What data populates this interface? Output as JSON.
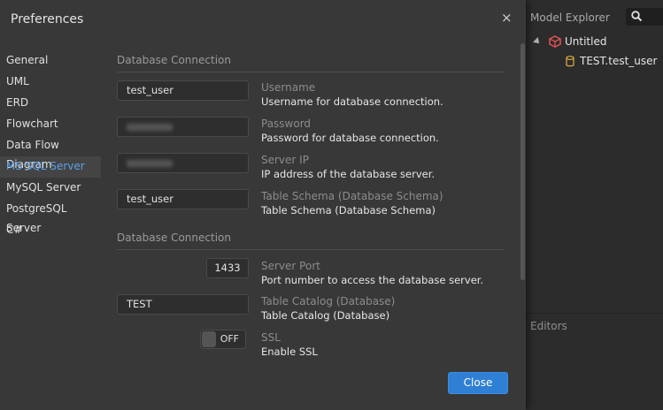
{
  "explorer": {
    "title": "Model Explorer",
    "tree": [
      {
        "label": "Untitled",
        "icon": "cube-icon"
      },
      {
        "label": "TEST.test_user",
        "icon": "database-icon"
      }
    ],
    "editors_label": "Editors"
  },
  "dialog": {
    "title": "Preferences",
    "close_symbol": "×",
    "nav": [
      "General",
      "UML",
      "ERD",
      "Flowchart",
      "Data Flow Diagram",
      "MS SQL Server",
      "MySQL Server",
      "PostgreSQL Server",
      "C#"
    ],
    "active_nav": "MS SQL Server",
    "sections": [
      "Database Connection",
      "Database Connection"
    ],
    "fields": {
      "username": {
        "value": "test_user",
        "title": "Username",
        "desc": "Username for database connection."
      },
      "password": {
        "value": "",
        "title": "Password",
        "desc": "Password for database connection."
      },
      "server_ip": {
        "value": "",
        "title": "Server IP",
        "desc": "IP address of the database server."
      },
      "table_schema": {
        "value": "test_user",
        "title": "Table Schema (Database Schema)",
        "desc": "Table Schema (Database Schema)"
      },
      "server_port": {
        "value": "1433",
        "title": "Server Port",
        "desc": "Port number to access the database server."
      },
      "table_catalog": {
        "value": "TEST",
        "title": "Table Catalog (Database)",
        "desc": "Table Catalog (Database)"
      },
      "ssl": {
        "value": "OFF",
        "title": "SSL",
        "desc": "Enable SSL"
      }
    },
    "close_button": "Close"
  },
  "colors": {
    "accent": "#2f7fd5",
    "active_nav_text": "#5aa0e6",
    "cube_icon": "#e05252",
    "database_icon": "#e0b040"
  }
}
